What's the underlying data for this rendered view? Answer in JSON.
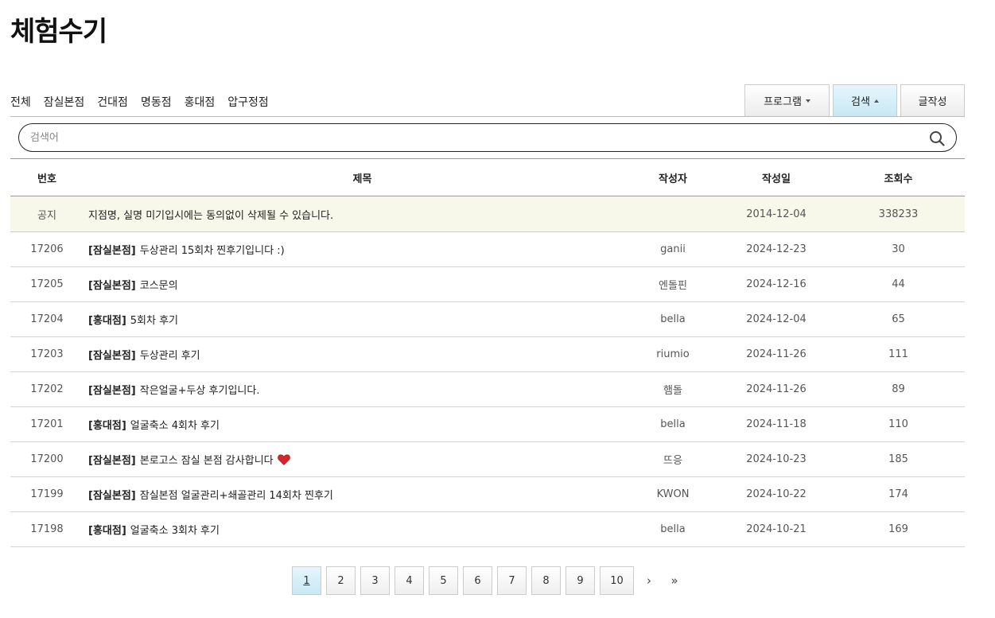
{
  "page": {
    "title": "체험수기"
  },
  "filters": [
    "전체",
    "잠실본점",
    "건대점",
    "명동점",
    "홍대점",
    "압구정점"
  ],
  "buttons": {
    "program": "프로그램",
    "search": "검색",
    "write": "글작성"
  },
  "search": {
    "placeholder": "검색어",
    "value": ""
  },
  "table": {
    "headers": {
      "num": "번호",
      "title": "제목",
      "author": "작성자",
      "date": "작성일",
      "views": "조회수"
    },
    "notice": {
      "num": "공지",
      "title": "지점명, 실명 미기입시에는 동의없이 삭제될 수 있습니다.",
      "author": "",
      "date": "2014-12-04",
      "views": "338233"
    },
    "rows": [
      {
        "num": "17206",
        "category": "[잠실본점]",
        "title": "두상관리 15회차 찐후기입니다 :)",
        "author": "ganii",
        "date": "2024-12-23",
        "views": "30"
      },
      {
        "num": "17205",
        "category": "[잠실본점]",
        "title": "코스문의",
        "author": "엔돌핀",
        "date": "2024-12-16",
        "views": "44"
      },
      {
        "num": "17204",
        "category": "[홍대점]",
        "title": "5회차 후기",
        "author": "bella",
        "date": "2024-12-04",
        "views": "65"
      },
      {
        "num": "17203",
        "category": "[잠실본점]",
        "title": "두상관리 후기",
        "author": "riumio",
        "date": "2024-11-26",
        "views": "111"
      },
      {
        "num": "17202",
        "category": "[잠실본점]",
        "title": "작은얼굴+두상 후기입니다.",
        "author": "햄돌",
        "date": "2024-11-26",
        "views": "89"
      },
      {
        "num": "17201",
        "category": "[홍대점]",
        "title": "얼굴축소 4회차 후기",
        "author": "bella",
        "date": "2024-11-18",
        "views": "110"
      },
      {
        "num": "17200",
        "category": "[잠실본점]",
        "title": "본로고스 잠실 본점 감사합니다",
        "author": "뜨응",
        "date": "2024-10-23",
        "views": "185"
      },
      {
        "num": "17199",
        "category": "[잠실본점]",
        "title": "잠실본점 얼굴관리+쇄골관리 14회차 찐후기",
        "author": "KWON",
        "date": "2024-10-22",
        "views": "174"
      },
      {
        "num": "17198",
        "category": "[홍대점]",
        "title": "얼굴축소 3회차 후기",
        "author": "bella",
        "date": "2024-10-21",
        "views": "169"
      }
    ]
  },
  "pagination": {
    "pages": [
      "1",
      "2",
      "3",
      "4",
      "5",
      "6",
      "7",
      "8",
      "9",
      "10"
    ],
    "current": "1",
    "next": "›",
    "last": "»"
  },
  "colors": {
    "accent": "#d3edf7",
    "notice_bg": "#f7f7ea",
    "heart": "#d8242b"
  }
}
